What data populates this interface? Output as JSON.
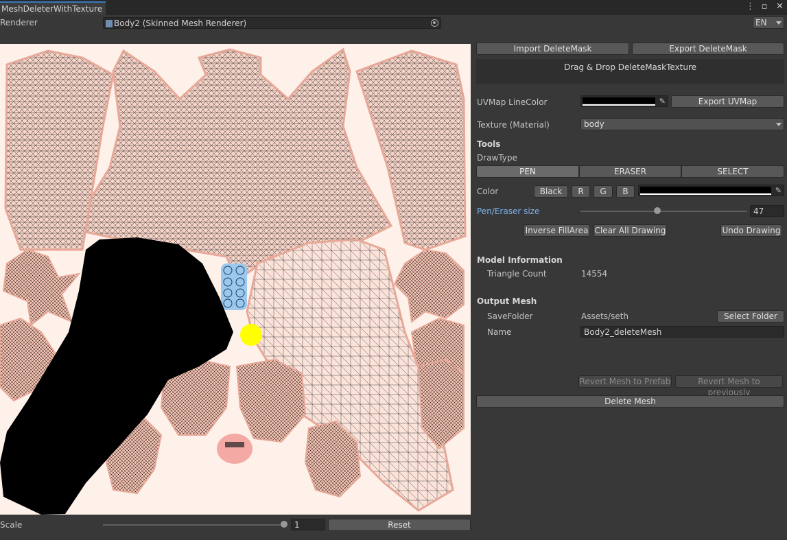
{
  "window": {
    "tab_title": "MeshDeleterWithTexture",
    "more_icon": "kebab-menu-icon",
    "maximize_icon": "maximize-icon",
    "close_icon": "close-icon"
  },
  "renderer": {
    "label": "Renderer",
    "value": "Body2 (Skinned Mesh Renderer)",
    "language": "EN"
  },
  "canvas": {
    "content": "uv-map-texture",
    "background": "#fdf1ea",
    "mask_color": "#000000",
    "cursor_color": "#ffff00"
  },
  "scale": {
    "label": "Scale",
    "value": "1",
    "reset_label": "Reset"
  },
  "mask": {
    "import_label": "Import DeleteMask",
    "export_label": "Export DeleteMask",
    "drop_label": "Drag & Drop DeleteMaskTexture"
  },
  "uvmap": {
    "label": "UVMap LineColor",
    "color": "#000000",
    "export_label": "Export UVMap"
  },
  "texture": {
    "label": "Texture (Material)",
    "value": "body"
  },
  "tools": {
    "header": "Tools",
    "draw_type_label": "DrawType",
    "draw_types": [
      "PEN",
      "ERASER",
      "SELECT"
    ],
    "selected_draw_type": "PEN",
    "color_label": "Color",
    "color_buttons": [
      "Black",
      "R",
      "G",
      "B"
    ],
    "color": "#000000",
    "size_label": "Pen/Eraser size",
    "size_value": "47",
    "size_fraction": 0.46,
    "inverse_label": "Inverse FillArea",
    "clear_label": "Clear All Drawing",
    "undo_label": "Undo Drawing"
  },
  "model_info": {
    "header": "Model Information",
    "triangle_label": "Triangle Count",
    "triangle_value": "14554"
  },
  "output": {
    "header": "Output Mesh",
    "save_folder_label": "SaveFolder",
    "save_folder_value": "Assets/seth",
    "select_folder_label": "Select Folder",
    "name_label": "Name",
    "name_value": "Body2_deleteMesh",
    "revert_prefab_label": "Revert Mesh to Prefab",
    "revert_previous_label": "Revert Mesh to previously",
    "delete_label": "Delete Mesh"
  },
  "colors": {
    "accent": "#3a79bb",
    "label_blue": "#7cb4f0",
    "panel": "#383838"
  }
}
